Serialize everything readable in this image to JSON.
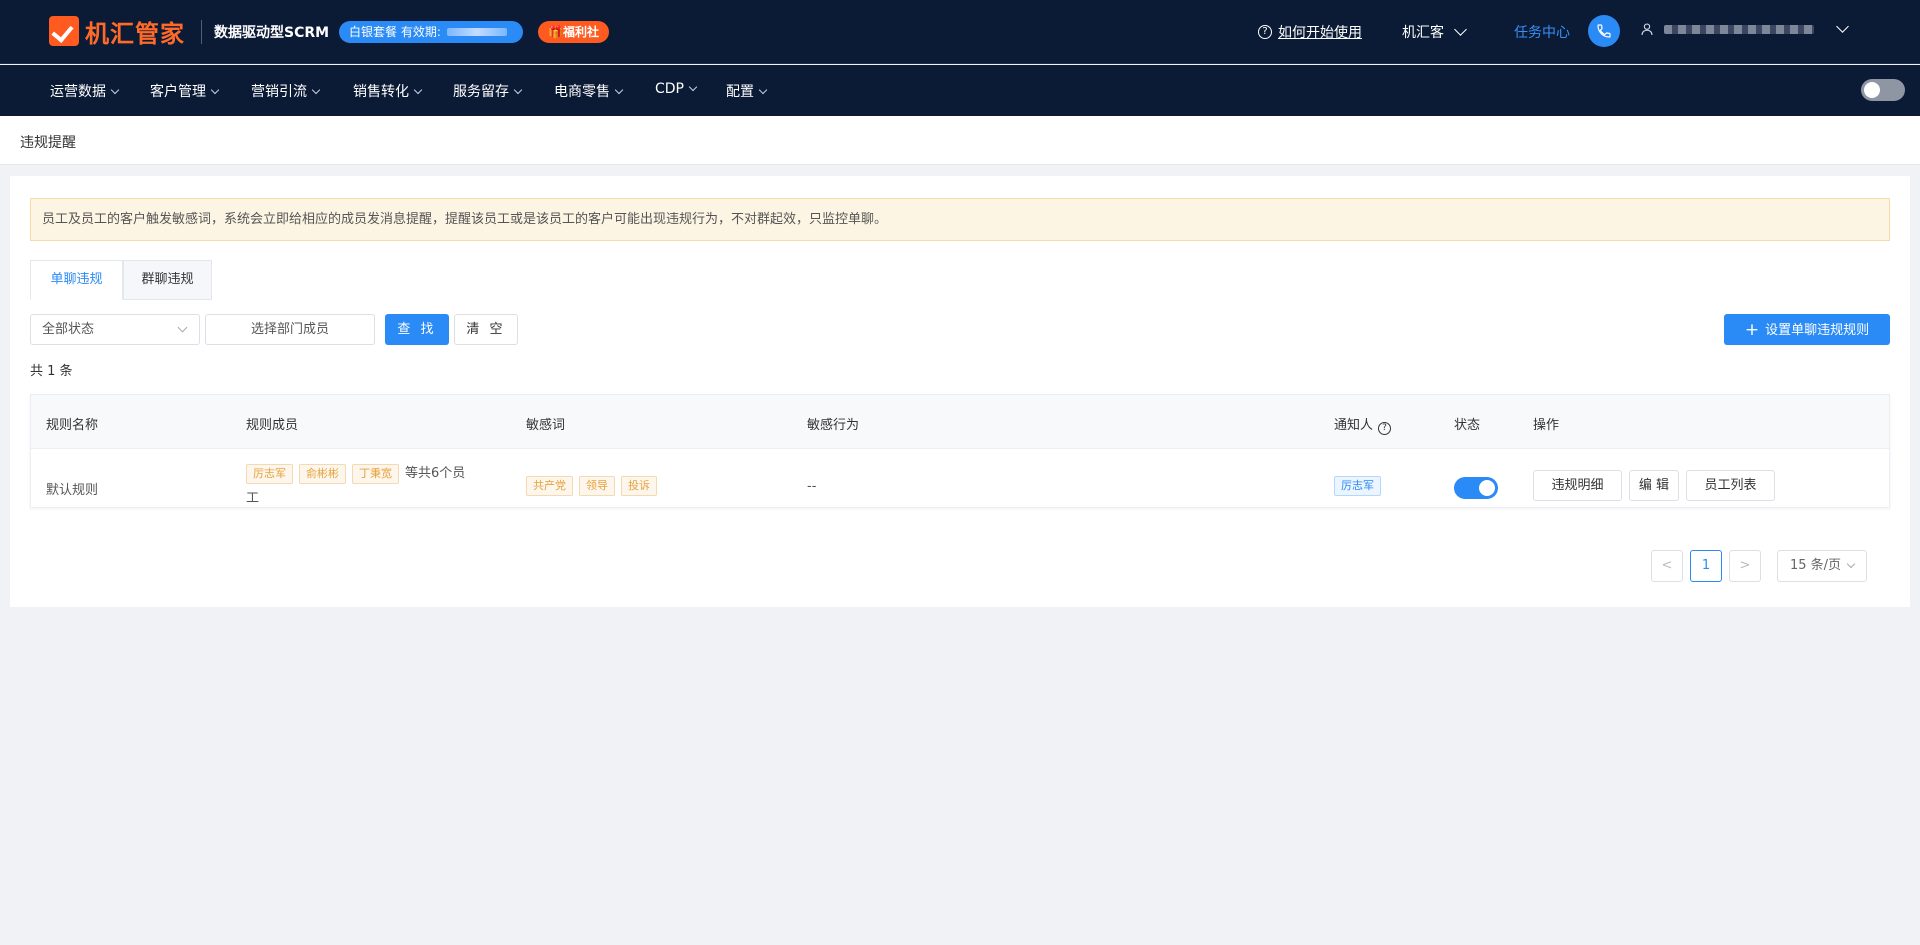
{
  "header": {
    "brand": "机汇管家",
    "subtitle": "数据驱动型SCRM",
    "plan_label": "白银套餐 有效期:",
    "welfare": "🎁福利社",
    "help": "如何开始使用",
    "org": "机汇客",
    "task_center": "任务中心"
  },
  "nav": {
    "items": [
      "运营数据",
      "客户管理",
      "营销引流",
      "销售转化",
      "服务留存",
      "电商零售",
      "CDP",
      "配置"
    ]
  },
  "breadcrumb": "违规提醒",
  "notice": "员工及员工的客户触发敏感词，系统会立即给相应的成员发消息提醒，提醒该员工或是该员工的客户可能出现违规行为，不对群起效，只监控单聊。",
  "tabs": [
    "单聊违规",
    "群聊违规"
  ],
  "filters": {
    "status_select": "全部状态",
    "member_button": "选择部门成员",
    "search": "查 找",
    "clear": "清 空",
    "setup": "设置单聊违规规则",
    "setup_plus": "+"
  },
  "count": "共 1 条",
  "table": {
    "headers": [
      "规则名称",
      "规则成员",
      "敏感词",
      "敏感行为",
      "通知人",
      "状态",
      "操作"
    ],
    "row": {
      "name": "默认规则",
      "members": [
        "厉志军",
        "俞彬彬",
        "丁秉宽"
      ],
      "members_more_line1": "等共6个员",
      "members_more_line2": "工",
      "words": [
        "共产党",
        "领导",
        "投诉"
      ],
      "behavior": "--",
      "notifier": "厉志军",
      "status_on": true,
      "ops": [
        "违规明细",
        "编 辑",
        "员工列表"
      ]
    }
  },
  "pagination": {
    "prev": "<",
    "current": "1",
    "next": ">",
    "page_size": "15 条/页"
  },
  "colors": {
    "primary": "#2a8af6",
    "header_bg": "#0b1a35",
    "brand_orange": "#ff5a1f"
  }
}
